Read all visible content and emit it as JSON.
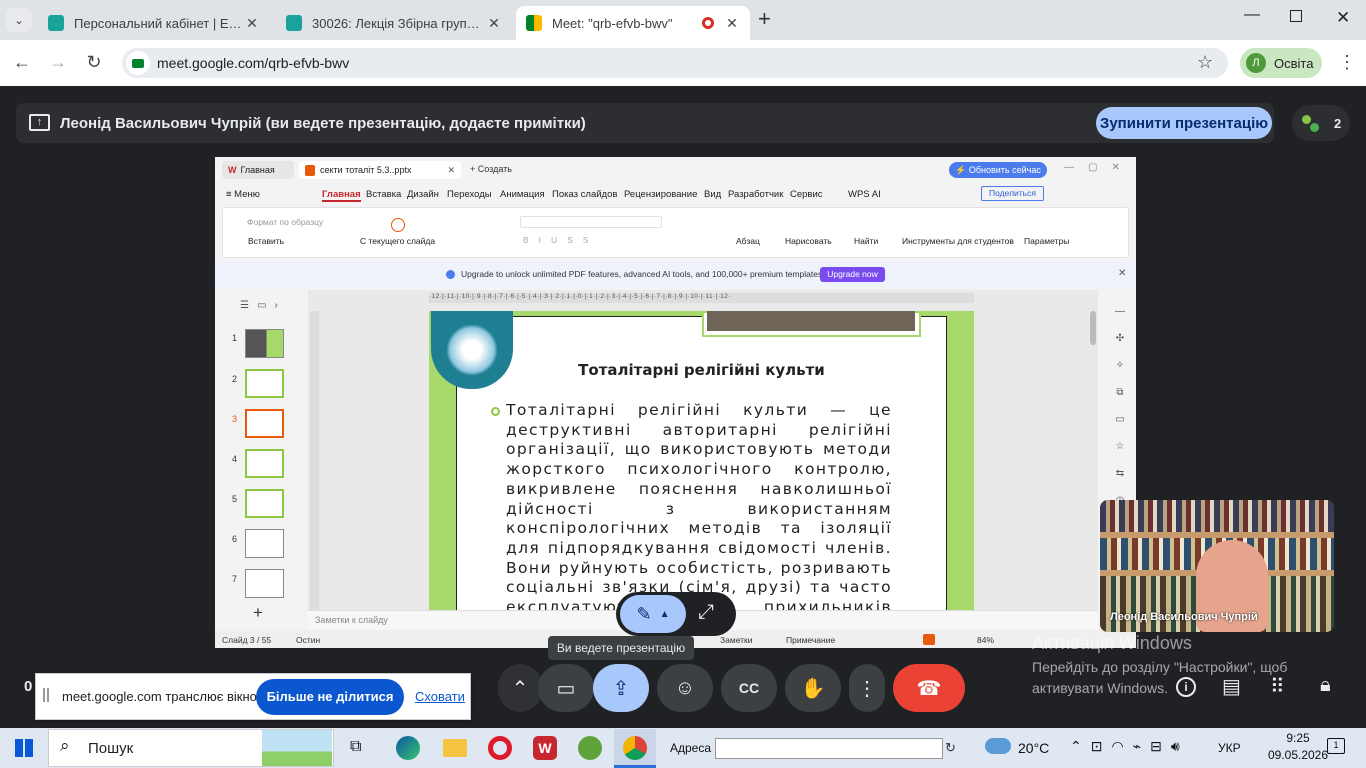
{
  "browser": {
    "tabs": [
      {
        "title": "Персональний кабінет | Е-нав"
      },
      {
        "title": "30026: Лекція Збірна група ДБ"
      },
      {
        "title": "Meet: \"qrb-efvb-bwv\""
      }
    ],
    "new_tab": "+",
    "url": "meet.google.com/qrb-efvb-bwv",
    "profile_initial": "Л",
    "profile_name": "Освіта"
  },
  "meet": {
    "presenter_banner": "Леонід Васильович Чупрій (ви ведете презентацію, додаєте примітки)",
    "stop_presenting": "Зупинити презентацію",
    "participant_count": "2",
    "presenting_tooltip": "Ви ведете презентацію",
    "video_name": "Леонід Васильович Чупрій",
    "time_left": "0",
    "share_notice": "meet.google.com транслює вікно.",
    "stop_sharing": "Більше не ділитися",
    "hide": "Сховати"
  },
  "wps": {
    "tab_home": "Главная",
    "tab_doc": "секти  тоталіт 5.3..pptx",
    "tab_create": "Создать",
    "update_btn": "⚡ Обновить сейчас",
    "menu": [
      "≡ Меню",
      "Главная",
      "Вставка",
      "Дизайн",
      "Переходы",
      "Анимация",
      "Показ слайдов",
      "Рецензирование",
      "Вид",
      "Разработчик",
      "Сервис",
      "WPS AI"
    ],
    "share": "Поделиться",
    "ribbon": {
      "format_copy": "Формат по образцу",
      "paste": "Вставить",
      "from_current": "С текущего слайда",
      "paragraph": "Абзац",
      "draw": "Нарисовать",
      "find": "Найти",
      "student_tools": "Инструменты для студентов",
      "params": "Параметры"
    },
    "upgrade_text": "Upgrade to unlock unlimited PDF features, advanced AI tools, and 100,000+ premium templates.",
    "upgrade_btn": "Upgrade now",
    "slide_numbers": [
      "1",
      "2",
      "3",
      "4",
      "5",
      "6",
      "7"
    ],
    "add_slide": "+",
    "notes_placeholder": "Заметки к слайду",
    "status_slide": "Слайд 3 / 55",
    "status_theme": "Остин",
    "status_notes": "Заметки",
    "status_comment": "Примечание",
    "zoom": "84%",
    "ruler": "·12·|·11·|·10·|·9·|·8·|·7·|·6·|·5·|·4·|·3·|·2·|·1·|·0·|·1·|·2·|·3·|·4·|·5·|·6·|·7·|·8·|·9·|·10·|·11·|·12·"
  },
  "slide": {
    "title": "Тоталітарні релігійні культи",
    "body": "Тоталітарні релігійні культи — це деструктивні авторитарні релігійні організації, що використовують методи жорсткого психологічного контролю, викривлене пояснення навколишньої дійсності з використанням конспірологічних  методів та ізоляції для підпорядкування свідомості членів. Вони руйнують особистість, розривають соціальні зв'язки (сім'я, друзі) та часто експлуатують своїх прихильників заради"
  },
  "windows": {
    "activation_title": "Активація Windows",
    "activation_text": "Перейдіть до розділу \"Настройки\", щоб активувати Windows.",
    "search": "Пошук",
    "address_label": "Адреса",
    "weather": "20°C",
    "lang": "УКР",
    "time": "9:25",
    "date": "09.05.2026"
  },
  "colors": {
    "accent": "#a8c7fa",
    "hangup": "#ea4335",
    "slide_green": "#a6d86a",
    "wps_red": "#c7282f"
  }
}
